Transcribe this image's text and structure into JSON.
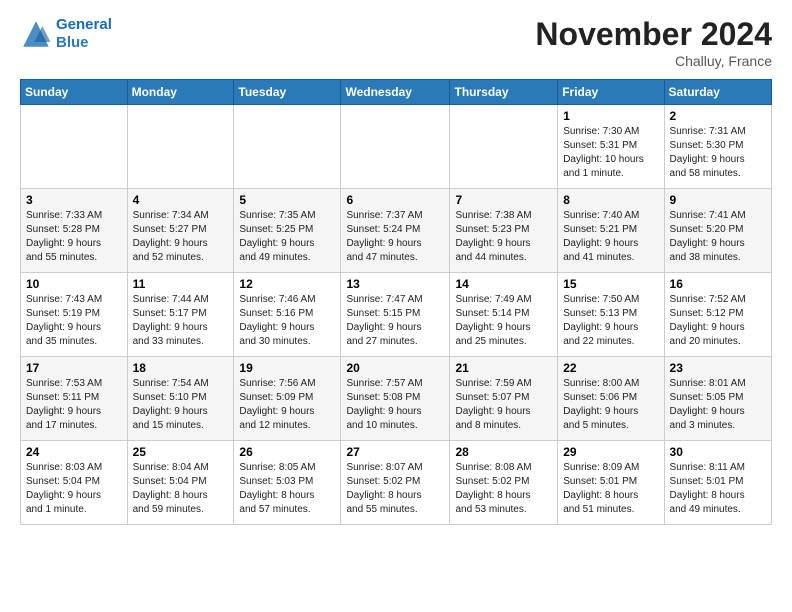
{
  "header": {
    "logo_line1": "General",
    "logo_line2": "Blue",
    "month_title": "November 2024",
    "location": "Challuy, France"
  },
  "weekdays": [
    "Sunday",
    "Monday",
    "Tuesday",
    "Wednesday",
    "Thursday",
    "Friday",
    "Saturday"
  ],
  "weeks": [
    [
      {
        "day": "",
        "info": ""
      },
      {
        "day": "",
        "info": ""
      },
      {
        "day": "",
        "info": ""
      },
      {
        "day": "",
        "info": ""
      },
      {
        "day": "",
        "info": ""
      },
      {
        "day": "1",
        "info": "Sunrise: 7:30 AM\nSunset: 5:31 PM\nDaylight: 10 hours\nand 1 minute."
      },
      {
        "day": "2",
        "info": "Sunrise: 7:31 AM\nSunset: 5:30 PM\nDaylight: 9 hours\nand 58 minutes."
      }
    ],
    [
      {
        "day": "3",
        "info": "Sunrise: 7:33 AM\nSunset: 5:28 PM\nDaylight: 9 hours\nand 55 minutes."
      },
      {
        "day": "4",
        "info": "Sunrise: 7:34 AM\nSunset: 5:27 PM\nDaylight: 9 hours\nand 52 minutes."
      },
      {
        "day": "5",
        "info": "Sunrise: 7:35 AM\nSunset: 5:25 PM\nDaylight: 9 hours\nand 49 minutes."
      },
      {
        "day": "6",
        "info": "Sunrise: 7:37 AM\nSunset: 5:24 PM\nDaylight: 9 hours\nand 47 minutes."
      },
      {
        "day": "7",
        "info": "Sunrise: 7:38 AM\nSunset: 5:23 PM\nDaylight: 9 hours\nand 44 minutes."
      },
      {
        "day": "8",
        "info": "Sunrise: 7:40 AM\nSunset: 5:21 PM\nDaylight: 9 hours\nand 41 minutes."
      },
      {
        "day": "9",
        "info": "Sunrise: 7:41 AM\nSunset: 5:20 PM\nDaylight: 9 hours\nand 38 minutes."
      }
    ],
    [
      {
        "day": "10",
        "info": "Sunrise: 7:43 AM\nSunset: 5:19 PM\nDaylight: 9 hours\nand 35 minutes."
      },
      {
        "day": "11",
        "info": "Sunrise: 7:44 AM\nSunset: 5:17 PM\nDaylight: 9 hours\nand 33 minutes."
      },
      {
        "day": "12",
        "info": "Sunrise: 7:46 AM\nSunset: 5:16 PM\nDaylight: 9 hours\nand 30 minutes."
      },
      {
        "day": "13",
        "info": "Sunrise: 7:47 AM\nSunset: 5:15 PM\nDaylight: 9 hours\nand 27 minutes."
      },
      {
        "day": "14",
        "info": "Sunrise: 7:49 AM\nSunset: 5:14 PM\nDaylight: 9 hours\nand 25 minutes."
      },
      {
        "day": "15",
        "info": "Sunrise: 7:50 AM\nSunset: 5:13 PM\nDaylight: 9 hours\nand 22 minutes."
      },
      {
        "day": "16",
        "info": "Sunrise: 7:52 AM\nSunset: 5:12 PM\nDaylight: 9 hours\nand 20 minutes."
      }
    ],
    [
      {
        "day": "17",
        "info": "Sunrise: 7:53 AM\nSunset: 5:11 PM\nDaylight: 9 hours\nand 17 minutes."
      },
      {
        "day": "18",
        "info": "Sunrise: 7:54 AM\nSunset: 5:10 PM\nDaylight: 9 hours\nand 15 minutes."
      },
      {
        "day": "19",
        "info": "Sunrise: 7:56 AM\nSunset: 5:09 PM\nDaylight: 9 hours\nand 12 minutes."
      },
      {
        "day": "20",
        "info": "Sunrise: 7:57 AM\nSunset: 5:08 PM\nDaylight: 9 hours\nand 10 minutes."
      },
      {
        "day": "21",
        "info": "Sunrise: 7:59 AM\nSunset: 5:07 PM\nDaylight: 9 hours\nand 8 minutes."
      },
      {
        "day": "22",
        "info": "Sunrise: 8:00 AM\nSunset: 5:06 PM\nDaylight: 9 hours\nand 5 minutes."
      },
      {
        "day": "23",
        "info": "Sunrise: 8:01 AM\nSunset: 5:05 PM\nDaylight: 9 hours\nand 3 minutes."
      }
    ],
    [
      {
        "day": "24",
        "info": "Sunrise: 8:03 AM\nSunset: 5:04 PM\nDaylight: 9 hours\nand 1 minute."
      },
      {
        "day": "25",
        "info": "Sunrise: 8:04 AM\nSunset: 5:04 PM\nDaylight: 8 hours\nand 59 minutes."
      },
      {
        "day": "26",
        "info": "Sunrise: 8:05 AM\nSunset: 5:03 PM\nDaylight: 8 hours\nand 57 minutes."
      },
      {
        "day": "27",
        "info": "Sunrise: 8:07 AM\nSunset: 5:02 PM\nDaylight: 8 hours\nand 55 minutes."
      },
      {
        "day": "28",
        "info": "Sunrise: 8:08 AM\nSunset: 5:02 PM\nDaylight: 8 hours\nand 53 minutes."
      },
      {
        "day": "29",
        "info": "Sunrise: 8:09 AM\nSunset: 5:01 PM\nDaylight: 8 hours\nand 51 minutes."
      },
      {
        "day": "30",
        "info": "Sunrise: 8:11 AM\nSunset: 5:01 PM\nDaylight: 8 hours\nand 49 minutes."
      }
    ]
  ]
}
